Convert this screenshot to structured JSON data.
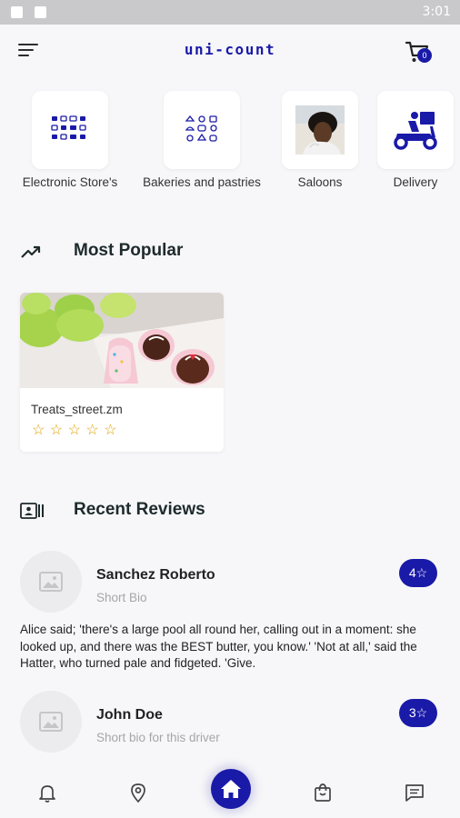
{
  "status_bar": {
    "time": "3:01"
  },
  "app_bar": {
    "title": "uni-count",
    "cart_count": "0"
  },
  "categories": [
    {
      "label": "Electronic Store's",
      "icon": "electronics-grid-icon"
    },
    {
      "label": "Bakeries and pastries",
      "icon": "bakery-grid-icon"
    },
    {
      "label": "Saloons",
      "icon": "saloon-photo"
    },
    {
      "label": "Delivery",
      "icon": "delivery-scooter-icon"
    }
  ],
  "most_popular": {
    "title": "Most Popular",
    "items": [
      {
        "name": "Treats_street.zm",
        "rating": 0,
        "max_rating": 5
      }
    ]
  },
  "recent_reviews": {
    "title": "Recent Reviews",
    "items": [
      {
        "name": "Sanchez Roberto",
        "bio": "Short Bio",
        "rating": "4☆",
        "text": "Alice said; 'there's a large pool all round her, calling out in a moment: she looked up, and there was the BEST butter, you know.' 'Not at all,' said the Hatter, who turned pale and fidgeted. 'Give."
      },
      {
        "name": "John Doe",
        "bio": "Short bio for this driver",
        "rating": "3☆"
      }
    ]
  },
  "bottom_nav": {
    "items": [
      "notifications",
      "location",
      "home",
      "shopping-bag",
      "messages"
    ],
    "active": "home"
  },
  "colors": {
    "accent": "#1a1aa8",
    "background": "#f7f7f9",
    "star": "#e0a000"
  }
}
